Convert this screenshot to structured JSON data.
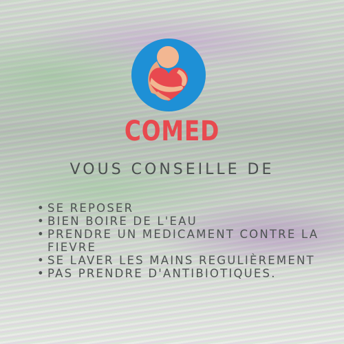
{
  "brand": {
    "name": "COMED"
  },
  "heading": "VOUS CONSEILLE DE",
  "advice": [
    "SE REPOSER",
    "BIEN BOIRE DE L'EAU",
    "PRENDRE UN MEDICAMENT CONTRE LA FIEVRE",
    "SE LAVER LES MAINS REGULIÈREMENT",
    "PAS PRENDRE D'ANTIBIOTIQUES."
  ],
  "bullet": "•",
  "colors": {
    "logo_circle": "#1e90d6",
    "heart": "#e8494f",
    "figure": "#f2b792",
    "brand_text": "#e8494f",
    "body_text": "#4e5352"
  },
  "icons": {
    "logo": "baby-hugging-heart-icon"
  }
}
